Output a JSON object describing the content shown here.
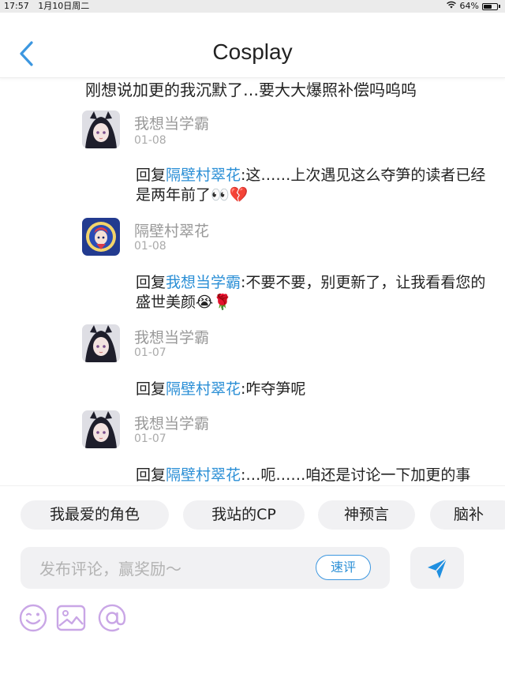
{
  "status_bar": {
    "time": "17:57",
    "date": "1月10日周二",
    "battery": "64%",
    "battery_level": 0.64
  },
  "nav": {
    "title": "Cosplay"
  },
  "truncated_line": "刚想说加更的我沉默了…要大大爆照补偿吗呜呜",
  "comments": [
    {
      "username": "我想当学霸",
      "date": "01-08",
      "reply_prefix": "回复",
      "mention": "隔壁村翠花",
      "text": ":这……上次遇见这么夺笋的读者已经是两年前了👀💔"
    },
    {
      "username": "隔壁村翠花",
      "date": "01-08",
      "reply_prefix": "回复",
      "mention": "我想当学霸",
      "text": ":不要不要，别更新了，让我看看您的盛世美颜😭🌹"
    },
    {
      "username": "我想当学霸",
      "date": "01-07",
      "reply_prefix": "回复",
      "mention": "隔壁村翠花",
      "text": ":咋夺笋呢"
    },
    {
      "username": "我想当学霸",
      "date": "01-07",
      "reply_prefix": "回复",
      "mention": "隔壁村翠花",
      "text": ":…呃……咱还是讨论一下加更的事"
    }
  ],
  "tags": [
    "我最爱的角色",
    "我站的CP",
    "神预言",
    "脑补"
  ],
  "comment_input": {
    "placeholder": "发布评论，赢奖励～",
    "value": ""
  },
  "quick_comment_label": "速评",
  "icons": {
    "back": "chevron-left-icon",
    "send": "send-icon",
    "emoji": "emoji-icon",
    "image": "image-icon",
    "mention": "at-icon"
  },
  "colors": {
    "accent": "#2b8fd6",
    "icon_purple": "#c9a6e6",
    "muted_text": "#999999",
    "chip_bg": "#f1f1f3"
  }
}
